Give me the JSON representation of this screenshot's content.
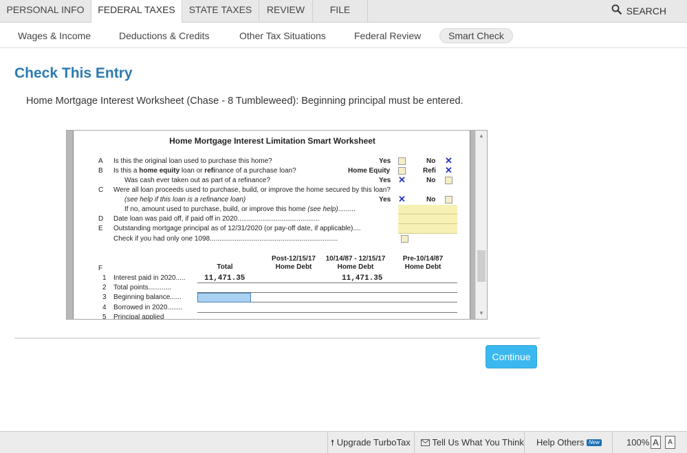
{
  "top_tabs": [
    "PERSONAL INFO",
    "FEDERAL TAXES",
    "STATE TAXES",
    "REVIEW",
    "FILE"
  ],
  "search_label": "SEARCH",
  "sub_nav": [
    "Wages & Income",
    "Deductions & Credits",
    "Other Tax Situations",
    "Federal Review",
    "Smart Check"
  ],
  "title": "Check This Entry",
  "message": "Home Mortgage Interest Worksheet (Chase - 8 Tumbleweed): Beginning principal must be entered.",
  "worksheet": {
    "title": "Home Mortgage Interest Limitation Smart Worksheet",
    "rowA": {
      "label": "A",
      "text": "Is this the original loan used to purchase this home?",
      "opt1": "Yes",
      "opt2": "No"
    },
    "rowB": {
      "label": "B",
      "text_pre": "Is this a ",
      "text_b1": "home equity",
      "text_mid": " loan or ",
      "text_b2": "refi",
      "text_post": "nance of a purchase loan?",
      "opt1": "Home Equity",
      "opt2": "Refi"
    },
    "rowB2": {
      "text": "Was cash ever taken out as part of a refinance?",
      "opt1": "Yes",
      "opt2": "No"
    },
    "rowC": {
      "label": "C",
      "text": "Were all loan proceeds used to purchase, build, or improve the home secured by this loan?"
    },
    "rowC2": {
      "text": "(see help if this loan is a refinance loan)",
      "opt1": "Yes",
      "opt2": "No"
    },
    "rowC3": {
      "text_pre": "If no, amount used to purchase, build, or improve this home ",
      "text_italic": "(see help)",
      "text_post": "........."
    },
    "rowD": {
      "label": "D",
      "text": "Date loan was paid off, if paid off in 2020..........................................."
    },
    "rowE": {
      "label": "E",
      "text": "Outstanding mortgage principal as of 12/31/2020 (or pay-off date, if applicable)...."
    },
    "rowE2": {
      "text": "Check if you had only one 1098..................................................................."
    },
    "col_headers": {
      "total": "Total",
      "post_line1": "Post-12/15/17",
      "post_line2": "Home Debt",
      "mid_line1": "10/14/87 - 12/15/17",
      "mid_line2": "Home Debt",
      "pre_line1": "Pre-10/14/87",
      "pre_line2": "Home Debt"
    },
    "section_F": "F",
    "lines": [
      {
        "num": "1",
        "label": "Interest paid in 2020.....",
        "total": "11,471.35",
        "mid": "11,471.35"
      },
      {
        "num": "2",
        "label": "Total points............"
      },
      {
        "num": "3",
        "label": "Beginning balance......"
      },
      {
        "num": "4",
        "label": "Borrowed in 2020........"
      },
      {
        "num": "5",
        "label": "Principal applied"
      }
    ]
  },
  "continue_label": "Continue",
  "footer": {
    "upgrade": "Upgrade TurboTax",
    "tell_us": "Tell Us What You Think",
    "help_others": "Help Others",
    "new_badge": "New",
    "zoom": "100%",
    "font_large": "A",
    "font_small": "A"
  },
  "colors": {
    "title": "#2a7ab0",
    "continue_button": "#3bb8ee",
    "checkbox_fill": "#f5efc8",
    "x_mark": "#2233bb",
    "active_field": "#a9d2f2"
  }
}
